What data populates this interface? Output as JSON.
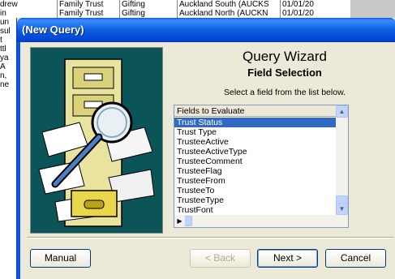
{
  "background": {
    "left_fragments": [
      "drew",
      "in",
      "un",
      "sul",
      "t",
      "ttl",
      "ya",
      "A",
      "n,",
      "ne"
    ],
    "cells": [
      "Family Trust",
      "Gifting",
      "Auckland South (AUCKS",
      "01/01/20"
    ],
    "cells_row2": [
      "Family Trust",
      "Gifting",
      "Auckland North (AUCKN",
      "01/01/20"
    ]
  },
  "dialog": {
    "title": "(New Query)",
    "heading": "Query Wizard",
    "subheading": "Field Selection",
    "instructions": "Select a field from the list below.",
    "list": {
      "header": "Fields to Evaluate",
      "items": [
        "Trust Status",
        "Trust Type",
        "TrusteeActive",
        "TrusteeActiveType",
        "TrusteeComment",
        "TrusteeFlag",
        "TrusteeFrom",
        "TrusteeTo",
        "TrusteeType",
        "TrustFont"
      ],
      "selected": "Trust Status"
    },
    "buttons": {
      "manual": "Manual",
      "back": "< Back",
      "next": "Next >",
      "cancel": "Cancel"
    }
  },
  "icons": {
    "scroll_up": "up-arrow",
    "scroll_down": "down-arrow",
    "scroll_left": "left-arrow",
    "scroll_right": "right-arrow"
  },
  "colors": {
    "titlebar": "#0b5fe0",
    "selection": "#316ac5",
    "art_background": "#0b5558"
  }
}
